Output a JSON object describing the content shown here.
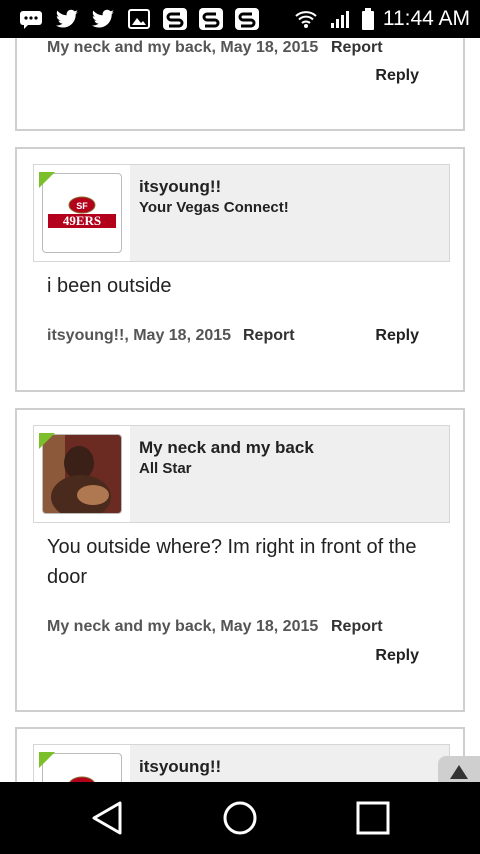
{
  "status_bar": {
    "time": "11:44 AM",
    "left_icons": [
      "chat-icon",
      "twitter-icon",
      "twitter-icon",
      "image-icon",
      "s-app-icon",
      "s-app-icon",
      "s-app-icon"
    ],
    "right_icons": [
      "wifi-icon",
      "signal-icon",
      "battery-icon"
    ]
  },
  "posts": [
    {
      "meta": "My neck and my back, May 18, 2015",
      "report_label": "Report",
      "reply_label": "Reply"
    },
    {
      "username": "itsyoung!!",
      "usertitle": "Your Vegas Connect!",
      "avatar": "49ers-logo",
      "message": "i been outside",
      "meta": "itsyoung!!, May 18, 2015",
      "report_label": "Report",
      "reply_label": "Reply"
    },
    {
      "username": "My neck and my back",
      "usertitle": "All Star",
      "avatar": "user-photo",
      "message": "You outside where? Im right in front of the door",
      "meta": "My neck and my back, May 18, 2015",
      "report_label": "Report",
      "reply_label": "Reply"
    },
    {
      "username": "itsyoung!!",
      "avatar": "49ers-logo"
    }
  ],
  "logo_text": "49ERS",
  "nav_bar": {
    "icons": [
      "back-icon",
      "home-icon",
      "recents-icon"
    ]
  },
  "colors": {
    "accent_green": "#7bbf2a",
    "card_bg": "#efefef",
    "border": "#cfcfcf"
  }
}
